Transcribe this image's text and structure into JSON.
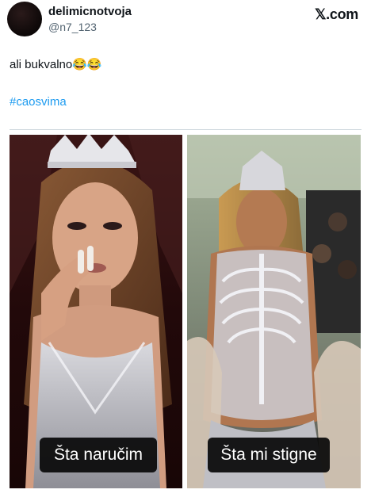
{
  "author": {
    "display_name": "delimicnotvoja",
    "handle": "@n7_123"
  },
  "brand": {
    "label": "𝕏.com"
  },
  "post": {
    "text": "ali bukvalno😂😂",
    "hashtag": "#caosvima"
  },
  "meme": {
    "left_caption": "Šta naručim",
    "right_caption": "Šta mi stigne"
  }
}
